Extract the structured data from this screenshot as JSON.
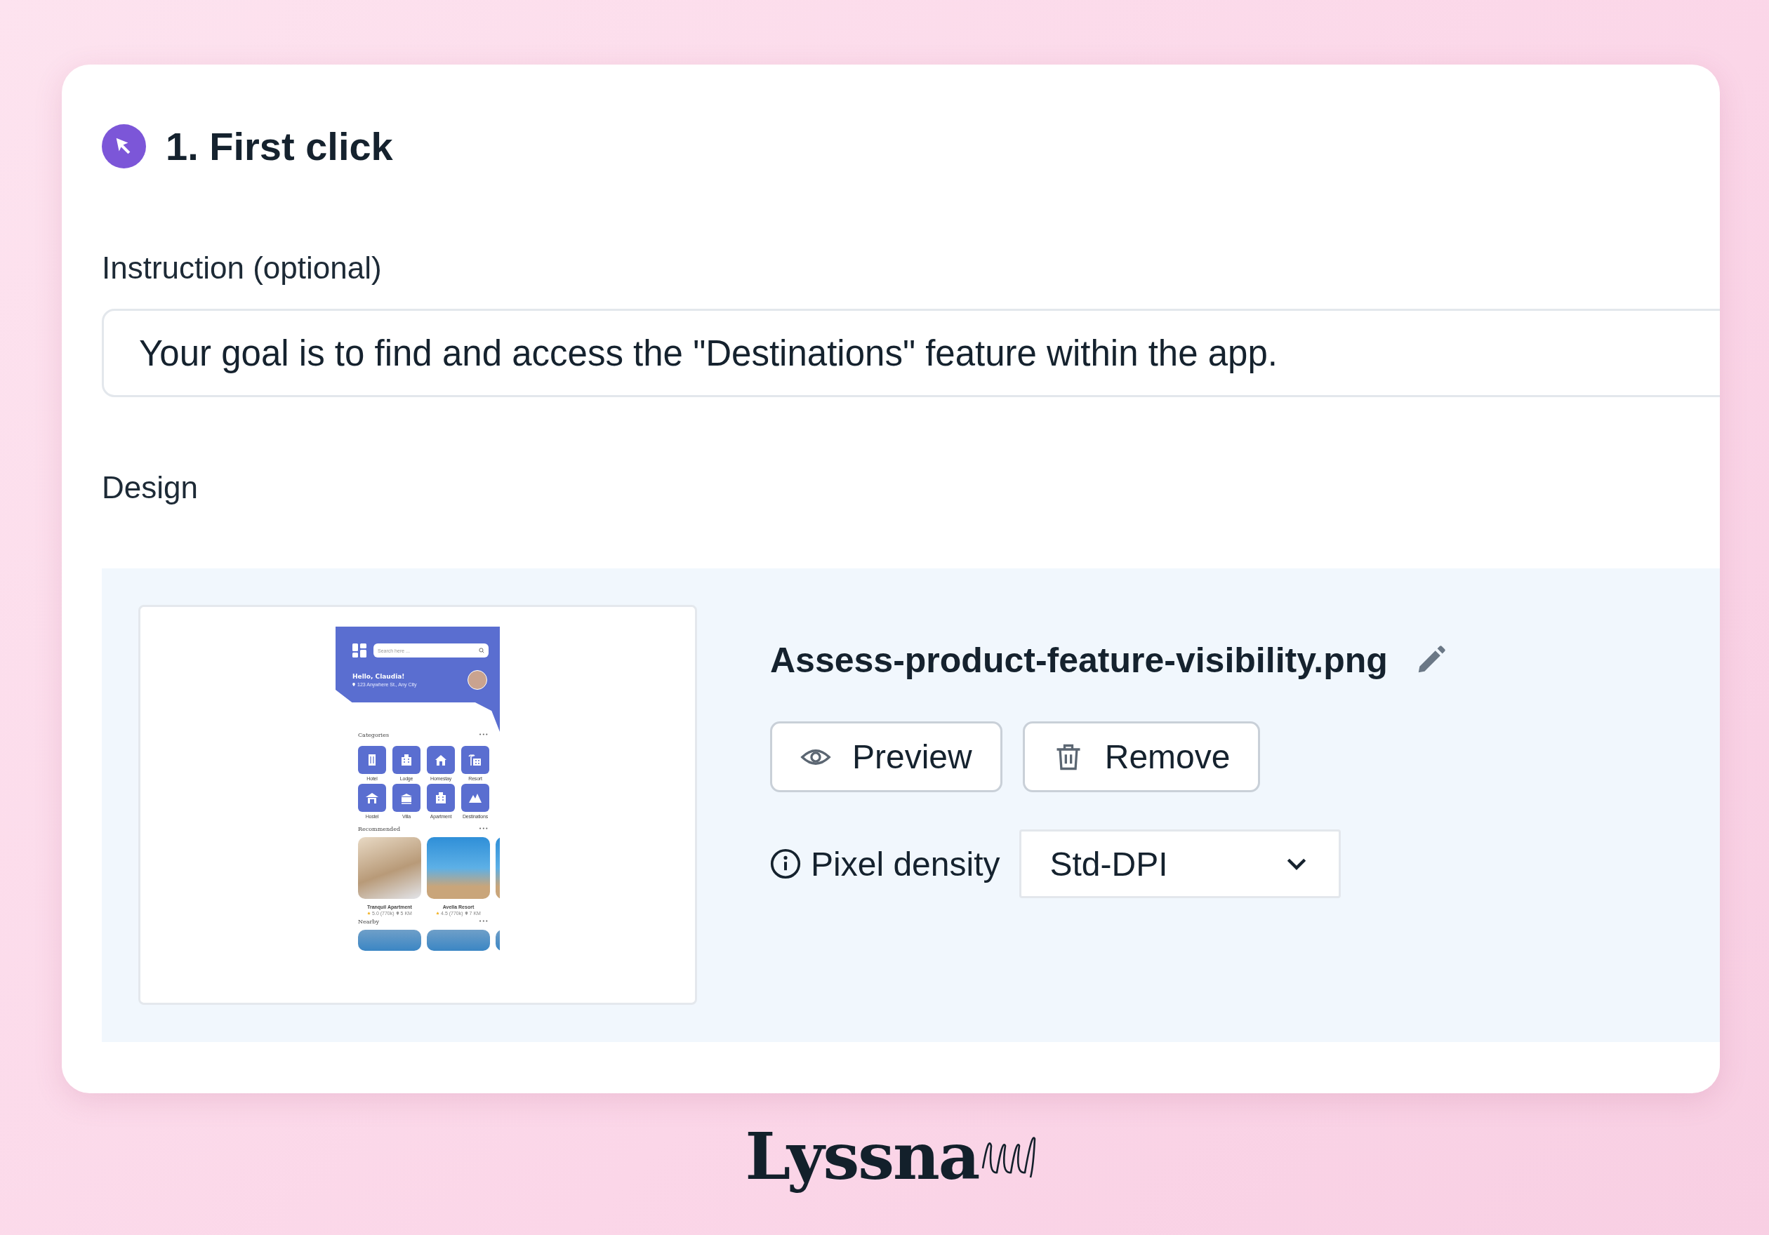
{
  "step": {
    "title": "1. First click"
  },
  "instruction": {
    "label": "Instruction (optional)",
    "value": "Your goal is to find and access the \"Destinations\" feature within the app."
  },
  "design": {
    "label": "Design",
    "file_name": "Assess-product-feature-visibility.png",
    "buttons": [
      {
        "label": "Preview",
        "kind": "preview"
      },
      {
        "label": "Remove",
        "kind": "remove"
      }
    ],
    "pixel_density": {
      "label": "Pixel density",
      "value": "Std-DPI"
    },
    "thumbnail": {
      "search_placeholder": "Search here ...",
      "greeting": "Hello, Claudia!",
      "address": "123 Anywhere St., Any City",
      "categories": {
        "title": "Categories",
        "more": "•••",
        "items": [
          {
            "label": "Hotel",
            "kind": "tower"
          },
          {
            "label": "Lodge",
            "kind": "building"
          },
          {
            "label": "Homestay",
            "kind": "house"
          },
          {
            "label": "Resort",
            "kind": "palm"
          },
          {
            "label": "Hostel",
            "kind": "hut"
          },
          {
            "label": "Villa",
            "kind": "villa"
          },
          {
            "label": "Apartment",
            "kind": "building"
          },
          {
            "label": "Destinations",
            "kind": "mountain"
          }
        ]
      },
      "recommended": {
        "title": "Recommended",
        "more": "•••",
        "items": [
          {
            "name": "Tranquil Apartment",
            "rating": "5.0 (770k)",
            "distance": "5 KM",
            "kind": "room"
          },
          {
            "name": "Avella Resort",
            "rating": "4.5 (770k)",
            "distance": "7 KM",
            "kind": "beach"
          }
        ]
      },
      "nearby": {
        "title": "Nearby",
        "more": "•••"
      }
    }
  },
  "brand": "Lyssna"
}
